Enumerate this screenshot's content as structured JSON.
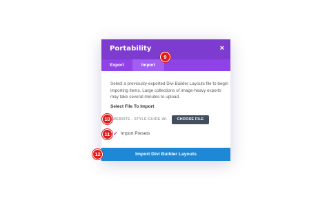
{
  "modal": {
    "title": "Portability",
    "close_icon": "×"
  },
  "tabs": [
    {
      "label": "Export"
    },
    {
      "label": "Import"
    }
  ],
  "description": "Select a previously-exported Divi Builder Layouts file to begin importing items. Large collections of image-heavy exports may take several minutes to upload.",
  "select_file_label": "Select File To Import",
  "file_input_value": "WEBSITE - STYLE GUIDE WI...",
  "choose_file_label": "CHOOSE FILE",
  "import_presets": {
    "label": "Import Presets",
    "checked": true,
    "check_glyph": "✓"
  },
  "import_button_label": "Import Divi Builder Layouts",
  "badges": [
    "9",
    "10",
    "11",
    "12"
  ],
  "colors": {
    "header": "#7e3bd0",
    "tabs": "#8f42e6",
    "active_tab": "#a25ef0",
    "button": "#1e88d6",
    "choose_file": "#424e5f",
    "badge": "#e01b1b"
  }
}
